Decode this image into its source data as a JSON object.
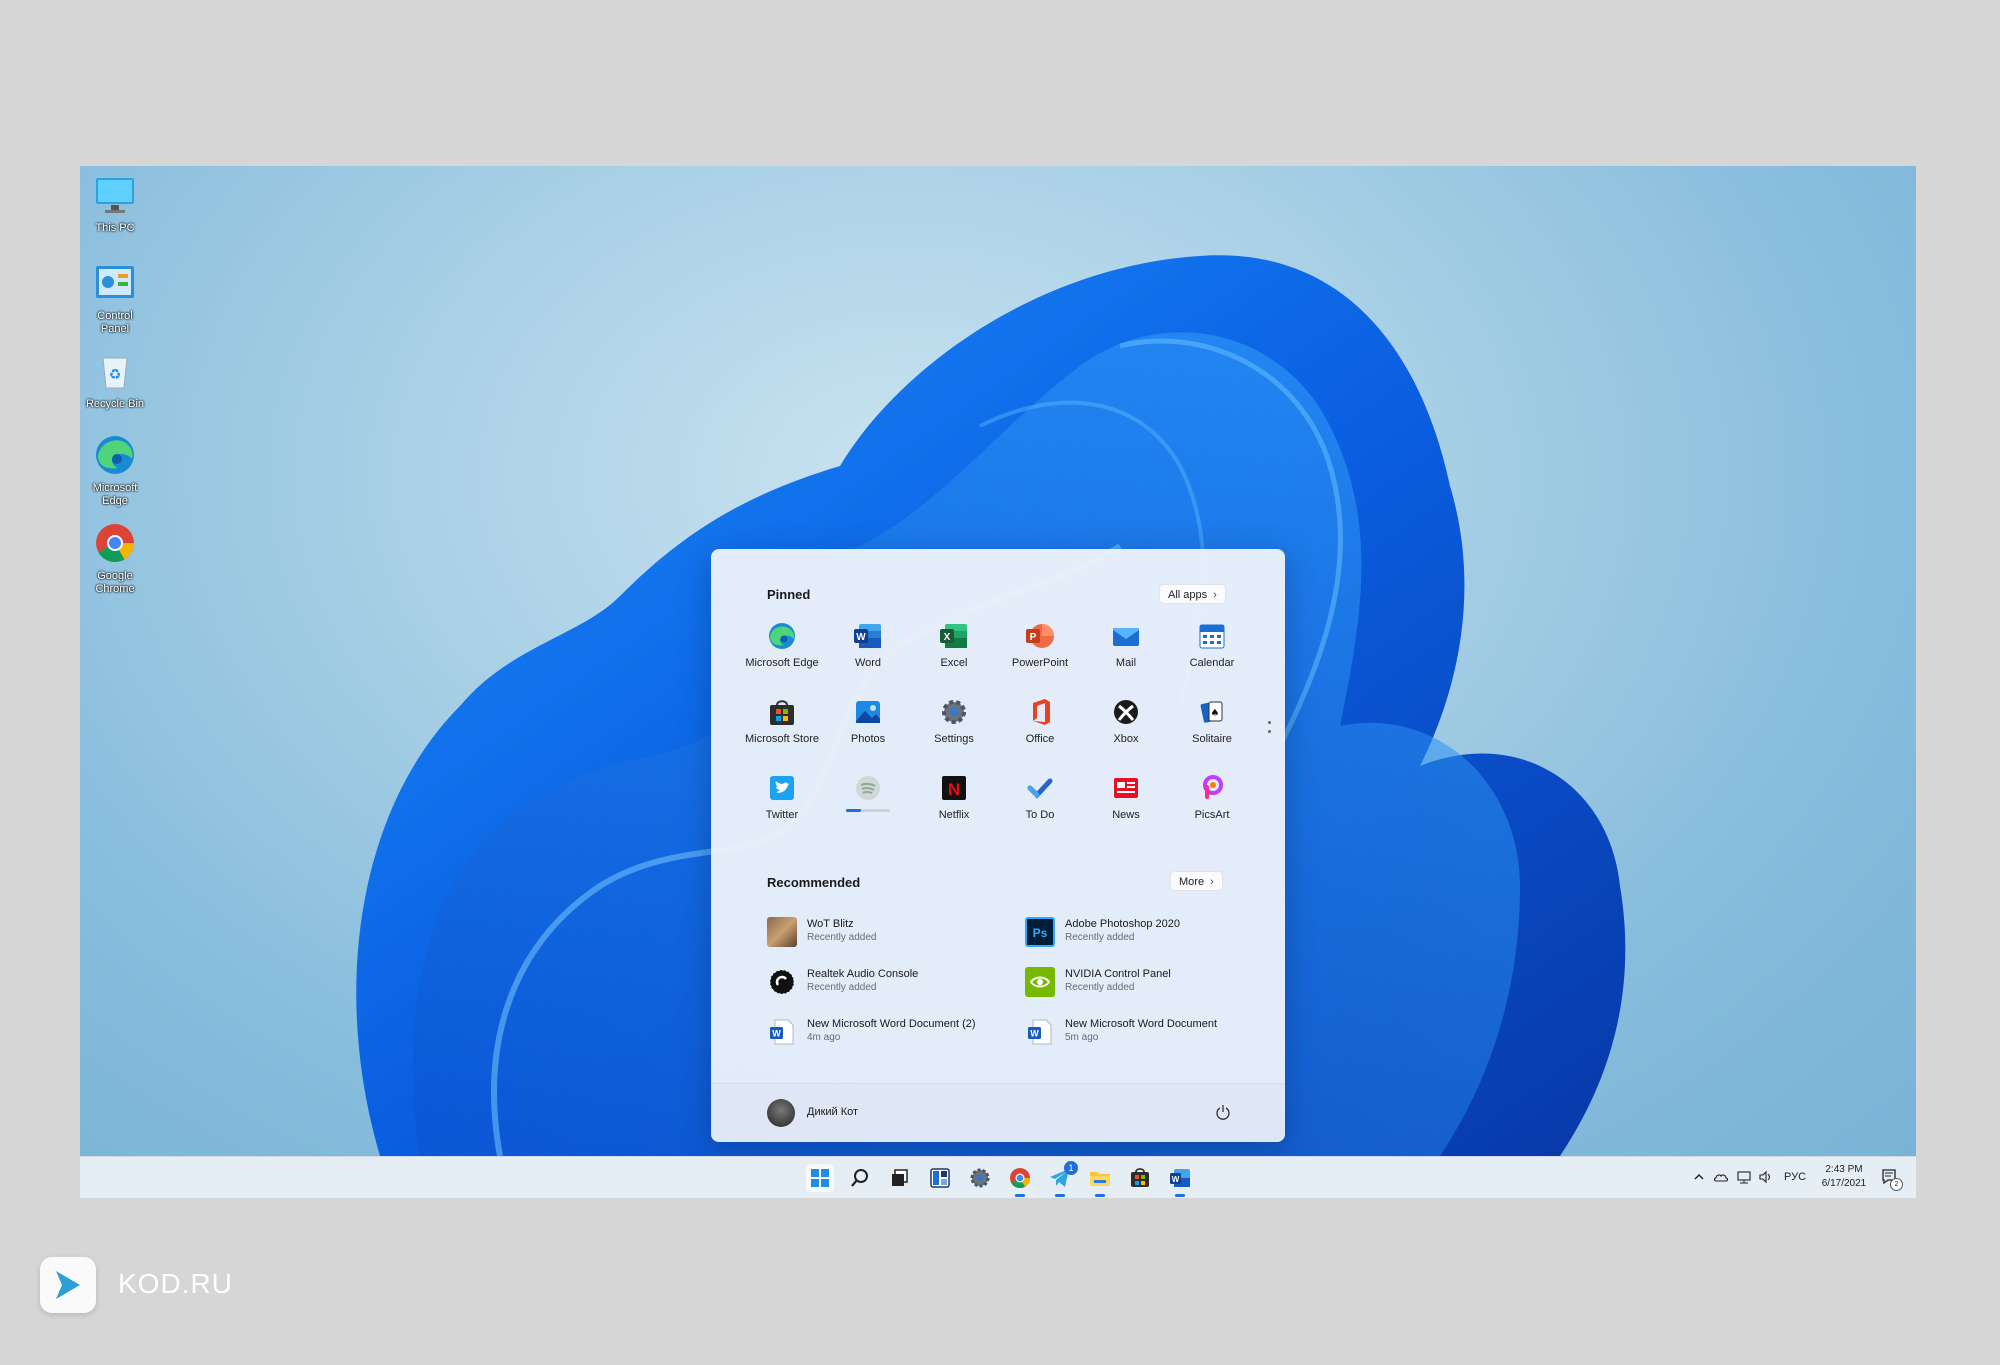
{
  "desktop_icons": [
    {
      "label": "This PC",
      "icon": "monitor-icon"
    },
    {
      "label": "Control Panel",
      "icon": "control-panel-icon"
    },
    {
      "label": "Recycle Bin",
      "icon": "recycle-bin-icon"
    },
    {
      "label": "Microsoft Edge",
      "icon": "edge-icon"
    },
    {
      "label": "Google Chrome",
      "icon": "chrome-icon"
    }
  ],
  "start": {
    "pinned_title": "Pinned",
    "all_apps_label": "All apps",
    "pinned": [
      {
        "label": "Microsoft Edge",
        "icon": "edge-icon"
      },
      {
        "label": "Word",
        "icon": "word-icon"
      },
      {
        "label": "Excel",
        "icon": "excel-icon"
      },
      {
        "label": "PowerPoint",
        "icon": "powerpoint-icon"
      },
      {
        "label": "Mail",
        "icon": "mail-icon"
      },
      {
        "label": "Calendar",
        "icon": "calendar-icon"
      },
      {
        "label": "Microsoft Store",
        "icon": "store-icon"
      },
      {
        "label": "Photos",
        "icon": "photos-icon"
      },
      {
        "label": "Settings",
        "icon": "settings-icon"
      },
      {
        "label": "Office",
        "icon": "office-icon"
      },
      {
        "label": "Xbox",
        "icon": "xbox-icon"
      },
      {
        "label": "Solitaire",
        "icon": "solitaire-icon"
      },
      {
        "label": "Twitter",
        "icon": "twitter-icon"
      },
      {
        "label": "",
        "icon": "spotify-icon",
        "progress": 0.35
      },
      {
        "label": "Netflix",
        "icon": "netflix-icon"
      },
      {
        "label": "To Do",
        "icon": "todo-icon"
      },
      {
        "label": "News",
        "icon": "news-icon"
      },
      {
        "label": "PicsArt",
        "icon": "picsart-icon"
      }
    ],
    "recommended_title": "Recommended",
    "more_label": "More",
    "recommended": [
      {
        "title": "WoT Blitz",
        "sub": "Recently added",
        "icon": "wot-blitz-icon"
      },
      {
        "title": "Adobe Photoshop 2020",
        "sub": "Recently added",
        "icon": "photoshop-icon"
      },
      {
        "title": "Realtek Audio Console",
        "sub": "Recently added",
        "icon": "realtek-icon"
      },
      {
        "title": "NVIDIA Control Panel",
        "sub": "Recently added",
        "icon": "nvidia-icon"
      },
      {
        "title": "New Microsoft Word Document (2)",
        "sub": "4m ago",
        "icon": "word-doc-icon"
      },
      {
        "title": "New Microsoft Word Document",
        "sub": "5m ago",
        "icon": "word-doc-icon"
      }
    ],
    "user_name": "Дикий Кот"
  },
  "taskbar": {
    "apps": [
      "start-icon",
      "search-icon",
      "task-view-icon",
      "widgets-icon",
      "settings-icon",
      "chrome-icon",
      "telegram-icon",
      "file-explorer-icon",
      "store-icon",
      "word-icon"
    ],
    "telegram_badge": "1",
    "language": "РУС",
    "time": "2:43 PM",
    "date": "6/17/2021",
    "notification_count": "2"
  },
  "watermark": "KOD.RU",
  "colors": {
    "accent": "#1f6fd6",
    "wallpaper": "#86bcdc",
    "start_bg": "#ecf1fa"
  }
}
